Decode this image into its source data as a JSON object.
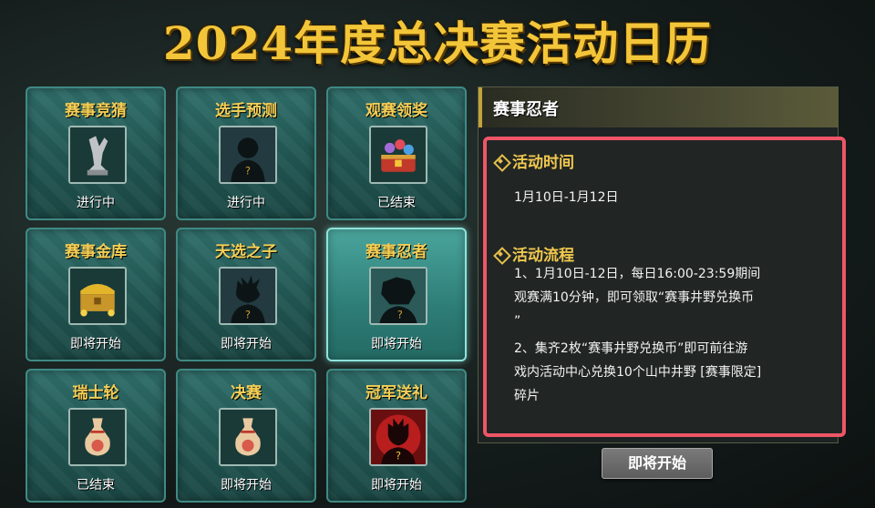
{
  "page": {
    "title": "2024年度总决赛活动日历"
  },
  "cards": [
    {
      "title": "赛事竞猜",
      "status": "进行中",
      "icon": "trophy-statue-icon"
    },
    {
      "title": "选手预测",
      "status": "进行中",
      "icon": "silhouette-icon"
    },
    {
      "title": "观赛领奖",
      "status": "已结束",
      "icon": "treasure-chest-icon"
    },
    {
      "title": "赛事金库",
      "status": "即将开始",
      "icon": "gold-chest-icon"
    },
    {
      "title": "天选之子",
      "status": "即将开始",
      "icon": "ninja-silhouette-icon"
    },
    {
      "title": "赛事忍者",
      "status": "即将开始",
      "icon": "ninja-silhouette-icon"
    },
    {
      "title": "瑞士轮",
      "status": "已结束",
      "icon": "scroll-bag-icon"
    },
    {
      "title": "决赛",
      "status": "即将开始",
      "icon": "scroll-bag-icon"
    },
    {
      "title": "冠军送礼",
      "status": "即将开始",
      "icon": "red-ninja-icon"
    }
  ],
  "side_panel": {
    "header": "赛事忍者",
    "time_title": "活动时间",
    "time_value": "1月10日-1月12日",
    "process_title": "活动流程",
    "process_line1_a": "1、1月10日-12日，每日16:00-23:59期间",
    "process_line1_b": "观赛满10分钟，即可领取“赛事井野兑换币",
    "process_line1_c": "”",
    "process_line2_a": "2、集齐2枚“赛事井野兑换币”即可前往游",
    "process_line2_b": "戏内活动中心兑换10个山中井野 [赛事限定]",
    "process_line2_c": "碎片"
  },
  "start_button": "即将开始",
  "colors": {
    "title_gold": "#f3c63a",
    "card_title": "#f4cf56",
    "highlight_border": "#ee5667",
    "card_bg": "#215652"
  }
}
